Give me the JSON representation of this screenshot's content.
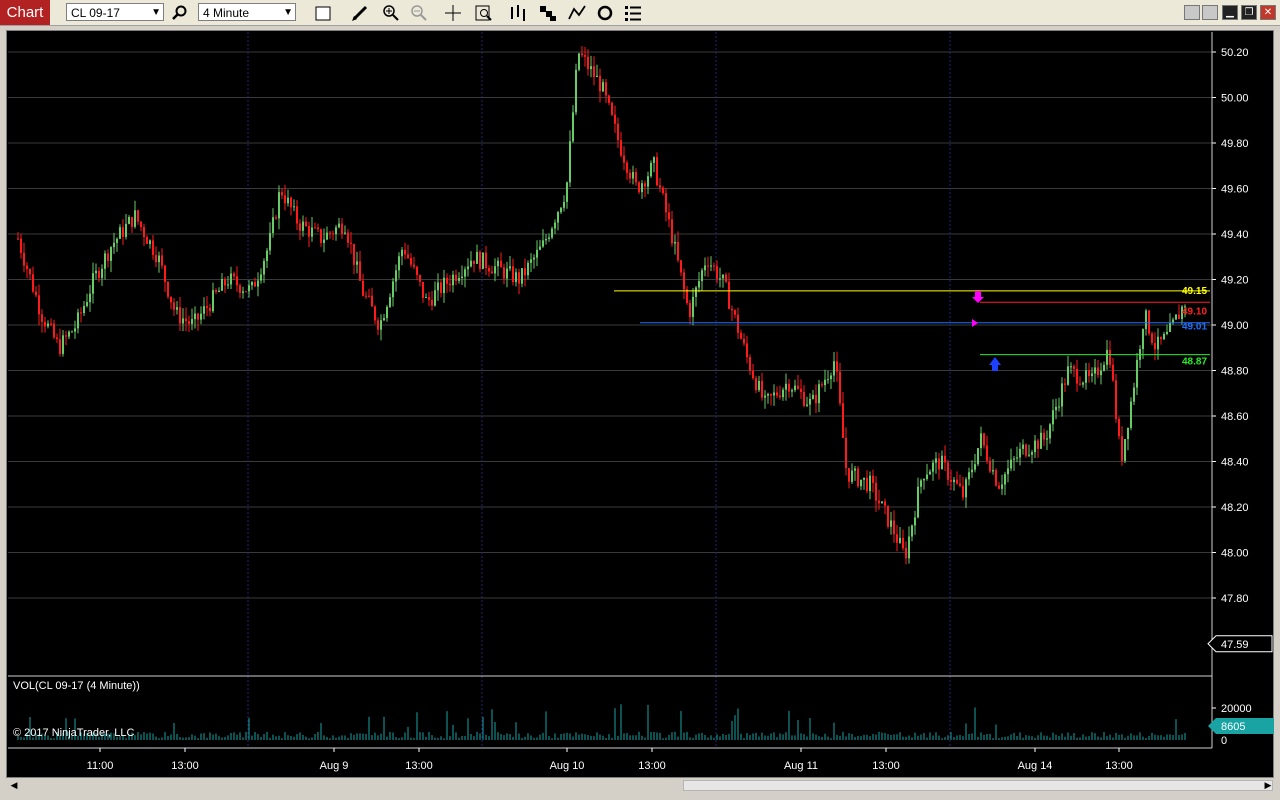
{
  "toolbar": {
    "chart_tab": "Chart",
    "instrument": "CL 09-17",
    "interval": "4 Minute"
  },
  "price_axis": {
    "labels": [
      "50.20",
      "50.00",
      "49.80",
      "49.60",
      "49.40",
      "49.20",
      "49.00",
      "48.80",
      "48.60",
      "48.40",
      "48.20",
      "48.00",
      "47.80"
    ],
    "last_price": "47.59"
  },
  "levels": [
    {
      "value": "49.15",
      "color": "#ffff00"
    },
    {
      "value": "49.10",
      "color": "#ff2020"
    },
    {
      "value": "49.01",
      "color": "#1e6fff"
    },
    {
      "value": "48.87",
      "color": "#22ee22"
    }
  ],
  "volume_panel": {
    "title": "VOL(CL 09-17 (4 Minute))",
    "axis_label": "20000",
    "zero_label": "0",
    "last_volume": "8605"
  },
  "copyright": "© 2017 NinjaTrader, LLC",
  "time_axis": [
    "11:00",
    "13:00",
    "Aug 9",
    "13:00",
    "Aug 10",
    "13:00",
    "Aug 11",
    "13:00",
    "Aug 14",
    "13:00"
  ],
  "colors": {
    "up_candle": "#66cc66",
    "down_candle": "#ff1a1a",
    "volume_bar": "#1aa3a3",
    "grid": "#3a3a3a",
    "session_divider": "#22227a",
    "marker_magenta": "#ff00ff",
    "marker_blue": "#1e40ff"
  },
  "chart_data": {
    "type": "line",
    "series": [
      {
        "values": [
          [
            0,
            49.38
          ],
          [
            0.02,
            49.05
          ],
          [
            0.035,
            48.9
          ],
          [
            0.05,
            49.0
          ],
          [
            0.065,
            49.2
          ],
          [
            0.08,
            49.35
          ],
          [
            0.1,
            49.48
          ],
          [
            0.12,
            49.3
          ],
          [
            0.135,
            49.05
          ],
          [
            0.15,
            49.0
          ],
          [
            0.165,
            49.1
          ],
          [
            0.18,
            49.2
          ],
          [
            0.2,
            49.15
          ],
          [
            0.215,
            49.35
          ],
          [
            0.225,
            49.6
          ],
          [
            0.24,
            49.45
          ],
          [
            0.26,
            49.38
          ],
          [
            0.28,
            49.45
          ],
          [
            0.295,
            49.15
          ],
          [
            0.31,
            49.0
          ],
          [
            0.33,
            49.35
          ],
          [
            0.35,
            49.1
          ],
          [
            0.37,
            49.2
          ],
          [
            0.39,
            49.3
          ],
          [
            0.41,
            49.25
          ],
          [
            0.43,
            49.2
          ],
          [
            0.45,
            49.35
          ],
          [
            0.47,
            49.6
          ],
          [
            0.48,
            50.2
          ],
          [
            0.5,
            50.05
          ],
          [
            0.515,
            49.8
          ],
          [
            0.53,
            49.6
          ],
          [
            0.545,
            49.7
          ],
          [
            0.56,
            49.4
          ],
          [
            0.575,
            49.05
          ],
          [
            0.59,
            49.3
          ],
          [
            0.605,
            49.18
          ],
          [
            0.625,
            48.85
          ],
          [
            0.64,
            48.65
          ],
          [
            0.66,
            48.75
          ],
          [
            0.68,
            48.65
          ],
          [
            0.7,
            48.85
          ],
          [
            0.71,
            48.35
          ],
          [
            0.73,
            48.3
          ],
          [
            0.75,
            48.1
          ],
          [
            0.76,
            47.98
          ],
          [
            0.775,
            48.35
          ],
          [
            0.79,
            48.4
          ],
          [
            0.81,
            48.25
          ],
          [
            0.825,
            48.5
          ],
          [
            0.84,
            48.3
          ],
          [
            0.86,
            48.45
          ],
          [
            0.88,
            48.5
          ],
          [
            0.9,
            48.8
          ],
          [
            0.92,
            48.75
          ],
          [
            0.935,
            48.9
          ],
          [
            0.945,
            48.4
          ],
          [
            0.955,
            48.7
          ],
          [
            0.965,
            49.05
          ],
          [
            0.975,
            48.9
          ],
          [
            0.985,
            48.95
          ],
          [
            1.0,
            49.1
          ]
        ]
      }
    ],
    "ylim": [
      47.5,
      50.25
    ]
  }
}
